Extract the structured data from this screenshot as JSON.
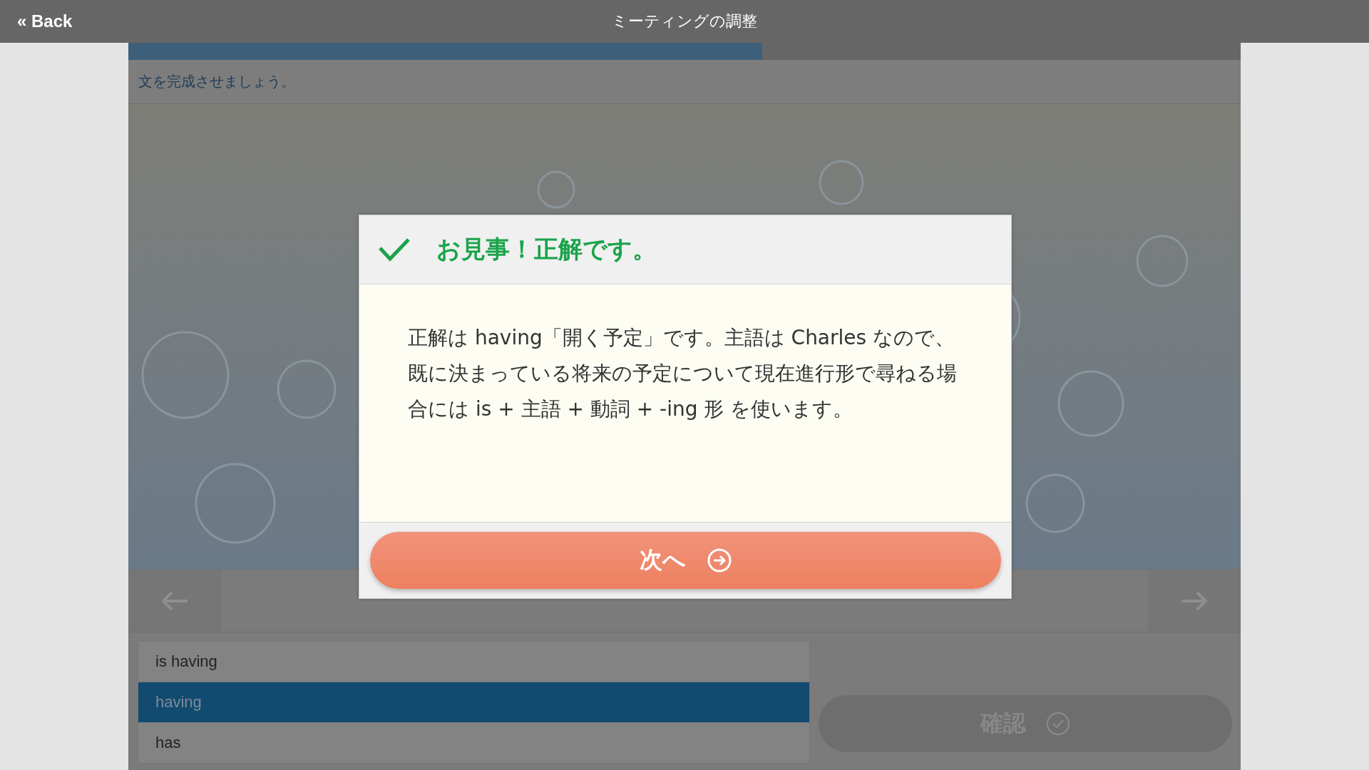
{
  "top_bar": {
    "back_link": "« Back",
    "title": "ミーティングの調整"
  },
  "progress": {
    "level": 0.57
  },
  "instruction": "文を完成させましょう。",
  "options": [
    {
      "label": "is having",
      "selected": false
    },
    {
      "label": "having",
      "selected": true
    },
    {
      "label": "has",
      "selected": false
    }
  ],
  "confirm_button": {
    "label": "確認",
    "disabled": true
  },
  "dialog": {
    "correct": true,
    "title": "お見事！正解です。",
    "explanation": "正解は having「開く予定」です。主語は Charles なので、既に決まっている将来の予定について現在進行形で尋ねる場合には is + 主語 + 動詞 + -ing 形 を使います。",
    "next_button": "次へ"
  }
}
